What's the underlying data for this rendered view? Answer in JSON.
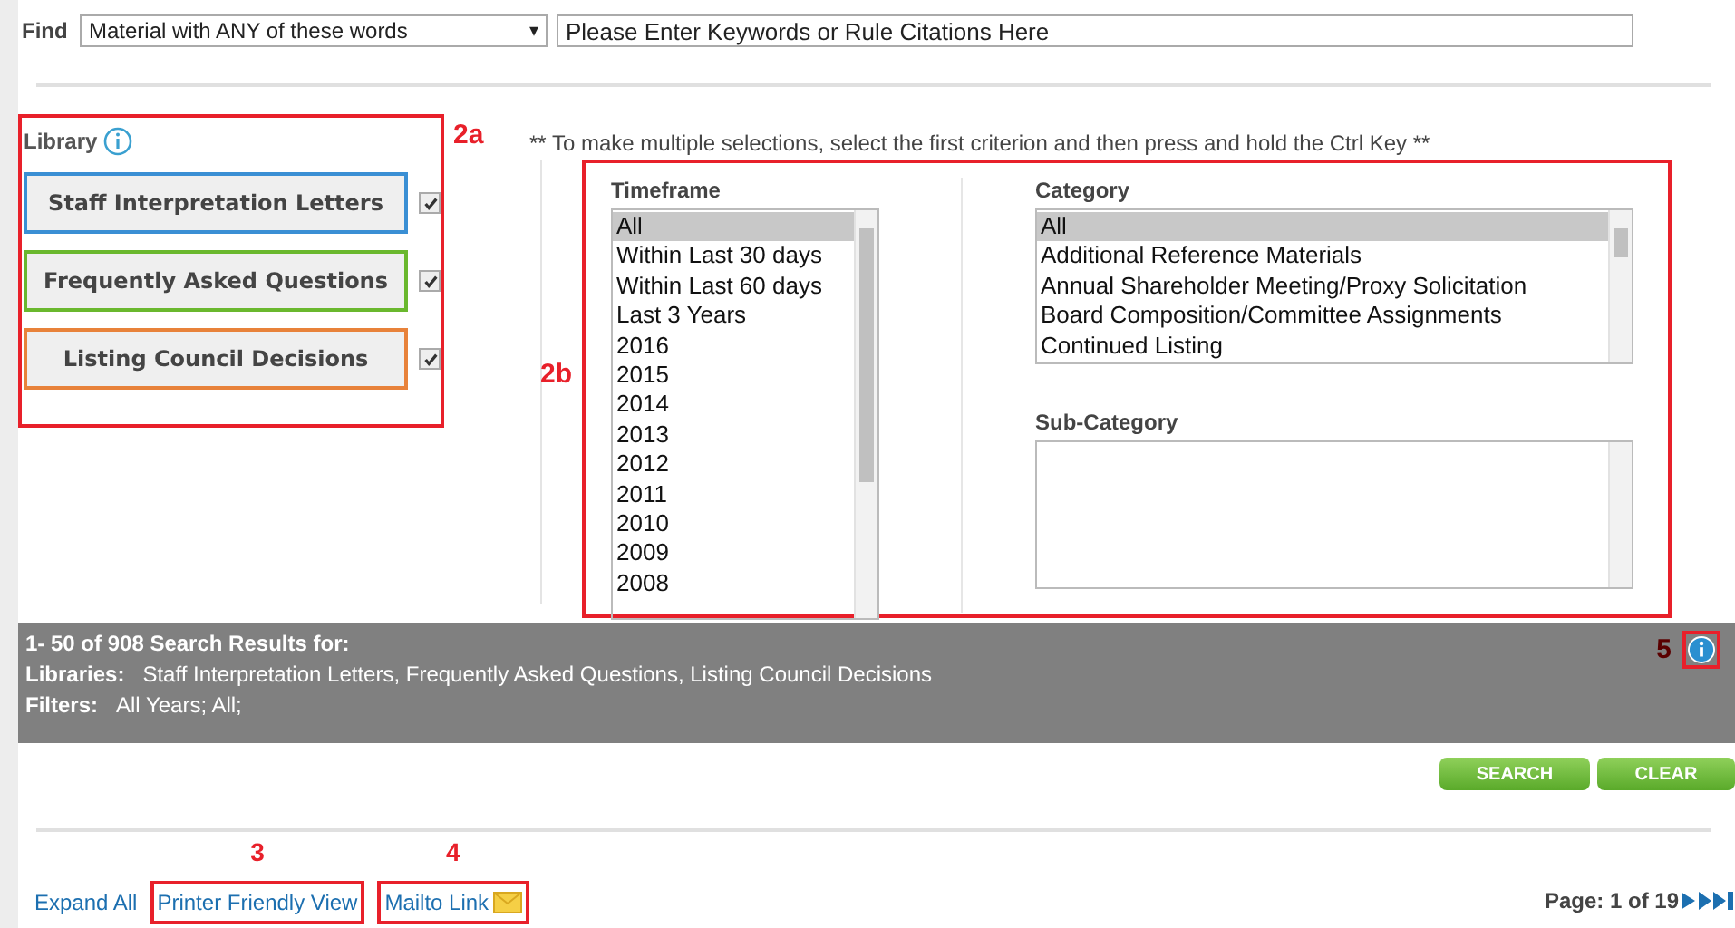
{
  "find": {
    "label": "Find",
    "mode": "Material with ANY of these words",
    "caret": "▾",
    "placeholder": "Please Enter Keywords or Rule Citations Here"
  },
  "library": {
    "title": "Library",
    "annotation": "2a",
    "items": [
      {
        "label": "Staff Interpretation Letters",
        "color": "#3a8fd4",
        "checked": true
      },
      {
        "label": "Frequently Asked Questions",
        "color": "#6ab82e",
        "checked": true
      },
      {
        "label": "Listing Council Decisions",
        "color": "#e8823a",
        "checked": true
      }
    ]
  },
  "hint": "** To make multiple selections, select the first criterion and then press and hold the Ctrl Key **",
  "filters": {
    "annotation": "2b",
    "timeframe": {
      "title": "Timeframe",
      "options": [
        {
          "label": "All",
          "selected": true
        },
        {
          "label": "Within Last 30 days",
          "selected": false
        },
        {
          "label": "Within Last 60 days",
          "selected": false
        },
        {
          "label": "Last 3 Years",
          "selected": false
        },
        {
          "label": "2016",
          "selected": false
        },
        {
          "label": "2015",
          "selected": false
        },
        {
          "label": "2014",
          "selected": false
        },
        {
          "label": "2013",
          "selected": false
        },
        {
          "label": "2012",
          "selected": false
        },
        {
          "label": "2011",
          "selected": false
        },
        {
          "label": "2010",
          "selected": false
        },
        {
          "label": "2009",
          "selected": false
        },
        {
          "label": "2008",
          "selected": false
        }
      ]
    },
    "category": {
      "title": "Category",
      "options": [
        {
          "label": "All",
          "selected": true
        },
        {
          "label": "Additional Reference Materials",
          "selected": false
        },
        {
          "label": "Annual Shareholder Meeting/Proxy Solicitation",
          "selected": false
        },
        {
          "label": "Board Composition/Committee Assignments",
          "selected": false
        },
        {
          "label": "Continued Listing",
          "selected": false
        }
      ]
    },
    "sub_category": {
      "title": "Sub-Category"
    }
  },
  "results": {
    "summary": "1- 50 of 908 Search Results for:",
    "libraries_label": "Libraries:",
    "libraries": "Staff Interpretation Letters, Frequently Asked Questions, Listing Council Decisions",
    "filters_label": "Filters:",
    "filters": "All Years; All;",
    "annotation": "5"
  },
  "buttons": [
    "SEARCH",
    "CLEAR"
  ],
  "links": [
    {
      "label": "Expand All",
      "kind": "plain"
    },
    {
      "label": "Printer Friendly View",
      "annotation": "3",
      "kind": "plain"
    },
    {
      "label": "Mailto Link",
      "annotation": "4",
      "kind": "mail"
    }
  ],
  "pager": {
    "label": "Page: 1 of 19"
  }
}
